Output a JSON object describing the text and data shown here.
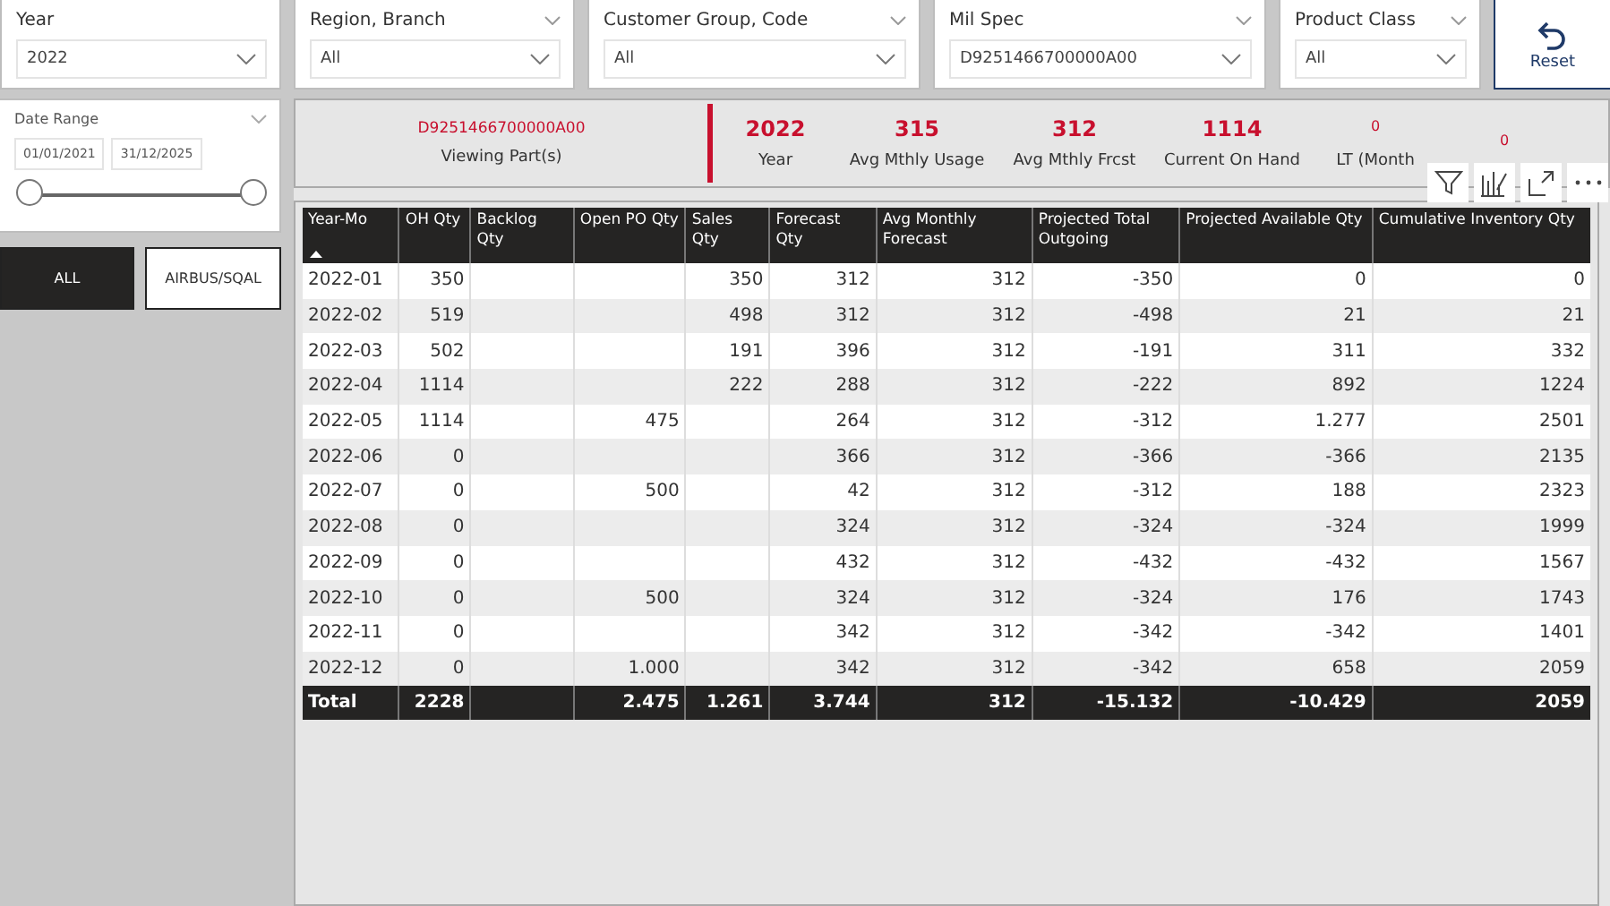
{
  "slicers": [
    {
      "title": "Year",
      "value": "2022",
      "header_chevron": false
    },
    {
      "title": "Region, Branch",
      "value": "All",
      "header_chevron": true
    },
    {
      "title": "Customer Group, Code",
      "value": "All",
      "header_chevron": true
    },
    {
      "title": "Mil Spec",
      "value": "D9251466700000A00",
      "header_chevron": true
    },
    {
      "title": "Product Class",
      "value": "All",
      "header_chevron": true
    }
  ],
  "reset": {
    "label": "Reset"
  },
  "date_range": {
    "title": "Date Range",
    "start": "01/01/2021",
    "end": "31/12/2025",
    "level": 1
  },
  "toggle_buttons": [
    {
      "label": "ALL",
      "selected": true
    },
    {
      "label": "AIRBUS/SQAL",
      "selected": false
    }
  ],
  "part_card": {
    "value": "D9251466700000A00",
    "label": "Viewing Part(s)"
  },
  "kpis": [
    {
      "value": "2022",
      "label": "Year",
      "kind": "large"
    },
    {
      "value": "315",
      "label": "Avg Mthly Usage",
      "kind": "large"
    },
    {
      "value": "312",
      "label": "Avg Mthly Frcst",
      "kind": "large"
    },
    {
      "value": "1114",
      "label": "Current On Hand",
      "kind": "large"
    },
    {
      "value": "0",
      "label": "LT (Month",
      "kind": "small"
    },
    {
      "value": "0",
      "kind": "small"
    }
  ],
  "table": {
    "columns": [
      {
        "label": "Year-Mo",
        "sorted": true
      },
      {
        "label": "OH Qty",
        "sorted": false
      },
      {
        "label": "Backlog Qty",
        "sorted": false
      },
      {
        "label": "Open PO Qty",
        "sorted": false
      },
      {
        "label": "Sales Qty",
        "sorted": false
      },
      {
        "label": "Forecast Qty",
        "sorted": false
      },
      {
        "label": "Avg Monthly Forecast",
        "sorted": false
      },
      {
        "label": "Projected Total Outgoing",
        "sorted": false
      },
      {
        "label": "Projected Available Qty",
        "sorted": false
      },
      {
        "label": "Cumulative Inventory Qty",
        "sorted": false
      }
    ],
    "rows": [
      {
        "kind": "data",
        "cells": [
          "2022-01",
          "350",
          null,
          null,
          "350",
          "312",
          "312",
          "-350",
          "0",
          "0"
        ]
      },
      {
        "kind": "data",
        "cells": [
          "2022-02",
          "519",
          null,
          null,
          "498",
          "312",
          "312",
          "-498",
          "21",
          "21"
        ]
      },
      {
        "kind": "data",
        "cells": [
          "2022-03",
          "502",
          null,
          null,
          "191",
          "396",
          "312",
          "-191",
          "311",
          "332"
        ]
      },
      {
        "kind": "data",
        "cells": [
          "2022-04",
          "1114",
          null,
          null,
          "222",
          "288",
          "312",
          "-222",
          "892",
          "1224"
        ]
      },
      {
        "kind": "data",
        "cells": [
          "2022-05",
          "1114",
          null,
          "475",
          null,
          "264",
          "312",
          "-312",
          "1.277",
          "2501"
        ]
      },
      {
        "kind": "data",
        "cells": [
          "2022-06",
          "0",
          null,
          null,
          null,
          "366",
          "312",
          "-366",
          "-366",
          "2135"
        ]
      },
      {
        "kind": "data",
        "cells": [
          "2022-07",
          "0",
          null,
          "500",
          null,
          "42",
          "312",
          "-312",
          "188",
          "2323"
        ]
      },
      {
        "kind": "data",
        "cells": [
          "2022-08",
          "0",
          null,
          null,
          null,
          "324",
          "312",
          "-324",
          "-324",
          "1999"
        ]
      },
      {
        "kind": "data",
        "cells": [
          "2022-09",
          "0",
          null,
          null,
          null,
          "432",
          "312",
          "-432",
          "-432",
          "1567"
        ]
      },
      {
        "kind": "data",
        "cells": [
          "2022-10",
          "0",
          null,
          "500",
          null,
          "324",
          "312",
          "-324",
          "176",
          "1743"
        ]
      },
      {
        "kind": "data",
        "cells": [
          "2022-11",
          "0",
          null,
          null,
          null,
          "342",
          "312",
          "-342",
          "-342",
          "1401"
        ]
      },
      {
        "kind": "data",
        "cells": [
          "2022-12",
          "0",
          null,
          "1.000",
          null,
          "342",
          "312",
          "-342",
          "658",
          "2059"
        ]
      },
      {
        "kind": "total",
        "cells": [
          "Total",
          "2228",
          null,
          "2.475",
          "1.261",
          "3.744",
          "312",
          "-15.132",
          "-10.429",
          "2059"
        ]
      }
    ]
  }
}
